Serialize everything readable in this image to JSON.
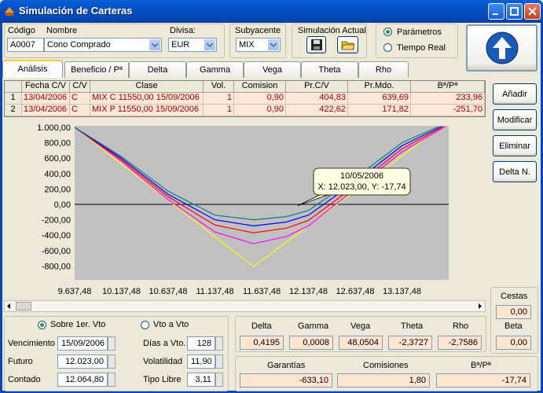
{
  "window": {
    "title": "Simulación de Carteras"
  },
  "header": {
    "codigo_label": "Código",
    "nombre_label": "Nombre",
    "codigo_value": "A0007",
    "nombre_value": "Cono Comprado",
    "divisa_label": "Divisa:",
    "divisa_value": "EUR",
    "subyacente_label": "Subyacente",
    "subyacente_value": "MIX",
    "simulacion_label": "Simulación Actual",
    "mode_options": [
      "Parámetros",
      "Tiempo Real"
    ],
    "mode_selected": "Parámetros"
  },
  "tabs": [
    "Análisis",
    "Beneficio / Pª",
    "Delta",
    "Gamma",
    "Vega",
    "Theta",
    "Rho"
  ],
  "active_tab": "Análisis",
  "grid": {
    "columns": [
      "",
      "Fecha C/V",
      "C/V",
      "Clase",
      "Vol.",
      "Comision",
      "Pr.C/V",
      "Pr.Mdo.",
      "Bª/Pª"
    ],
    "rows": [
      [
        "1",
        "13/04/2006",
        "C",
        "MIX C 11550,00 15/09/2006",
        "1",
        "0,90",
        "404,83",
        "639,69",
        "233,96"
      ],
      [
        "2",
        "13/04/2006",
        "C",
        "MIX P 11550,00 15/09/2006",
        "1",
        "0,90",
        "422,62",
        "171,82",
        "-251,70"
      ]
    ]
  },
  "side_buttons": [
    "Añadir",
    "Modificar",
    "Eliminar",
    "Delta N."
  ],
  "chart_data": {
    "type": "line",
    "x_ticks": [
      "9.637,48",
      "10.137,48",
      "10.637,48",
      "11.137,48",
      "11.637,48",
      "12.137,48",
      "12.637,48",
      "13.137,48"
    ],
    "y_ticks": [
      "1.000,00",
      "800,00",
      "600,00",
      "400,00",
      "200,00",
      "0,00",
      "-200,00",
      "-400,00",
      "-600,00",
      "-800,00"
    ],
    "xlim": [
      9637.48,
      13637.48
    ],
    "ylim": [
      -980,
      1020
    ],
    "tooltip": {
      "title": "10/05/2006",
      "text": "X: 12.023,00, Y: -17,74"
    },
    "tooltip_point": {
      "x": 12023,
      "y": -17.74
    },
    "series": [
      {
        "color": "#ffff00",
        "points": [
          [
            9637.48,
            1000
          ],
          [
            11550,
            -810
          ],
          [
            13550,
            1000
          ]
        ]
      },
      {
        "color": "#ff00ff",
        "points": [
          [
            9637.48,
            1000
          ],
          [
            10137.48,
            560
          ],
          [
            10637.48,
            60
          ],
          [
            11137.48,
            -360
          ],
          [
            11550,
            -510
          ],
          [
            11900,
            -420
          ],
          [
            12137.48,
            -280
          ],
          [
            12637.48,
            200
          ],
          [
            13137.48,
            680
          ],
          [
            13600,
            1010
          ]
        ]
      },
      {
        "color": "#ff0000",
        "points": [
          [
            9637.48,
            1000
          ],
          [
            10137.48,
            580
          ],
          [
            10637.48,
            100
          ],
          [
            11137.48,
            -270
          ],
          [
            11550,
            -370
          ],
          [
            11900,
            -310
          ],
          [
            12137.48,
            -210
          ],
          [
            12637.48,
            240
          ],
          [
            13137.48,
            720
          ],
          [
            13580,
            1010
          ]
        ]
      },
      {
        "color": "#0000ff",
        "points": [
          [
            9637.48,
            1000
          ],
          [
            10137.48,
            600
          ],
          [
            10637.48,
            130
          ],
          [
            11137.48,
            -200
          ],
          [
            11550,
            -280
          ],
          [
            11900,
            -230
          ],
          [
            12137.48,
            -140
          ],
          [
            12637.48,
            290
          ],
          [
            13137.48,
            760
          ],
          [
            13560,
            1010
          ]
        ]
      },
      {
        "color": "#008080",
        "points": [
          [
            9637.48,
            1000
          ],
          [
            10137.48,
            620
          ],
          [
            10637.48,
            170
          ],
          [
            11137.48,
            -140
          ],
          [
            11550,
            -200
          ],
          [
            11900,
            -160
          ],
          [
            12137.48,
            -80
          ],
          [
            12637.48,
            340
          ],
          [
            13137.48,
            800
          ],
          [
            13530,
            1010
          ]
        ]
      }
    ]
  },
  "cestas": {
    "label": "Cestas",
    "value": "0,00"
  },
  "beta": {
    "label": "Beta",
    "value": "0,00"
  },
  "params": {
    "radio_options": [
      "Sobre 1er. Vto",
      "Vto a Vto"
    ],
    "radio_selected": "Sobre 1er. Vto",
    "vencimiento_label": "Vencimiento",
    "vencimiento_value": "15/09/2006",
    "futuro_label": "Futuro",
    "futuro_value": "12.023,00",
    "contado_label": "Contado",
    "contado_value": "12.064,80",
    "dias_label": "Días a Vto.",
    "dias_value": "128",
    "volatilidad_label": "Volatilidad",
    "volatilidad_value": "11,90",
    "tipo_label": "Tipo Libre",
    "tipo_value": "3,11"
  },
  "greeks": {
    "labels": [
      "Delta",
      "Gamma",
      "Vega",
      "Theta",
      "Rho"
    ],
    "values": [
      "0,4195",
      "0,0008",
      "48,0504",
      "-2,3727",
      "-2,7586"
    ]
  },
  "totals": {
    "labels": [
      "Garantías",
      "Comisiones",
      "Bª/Pª"
    ],
    "values": [
      "-633,10",
      "1,80",
      "-17,74"
    ]
  },
  "colors": {
    "titlebar": "#0550c4",
    "row_bg": "#ffe7d7",
    "chart_bg": "#c0c0c0"
  }
}
